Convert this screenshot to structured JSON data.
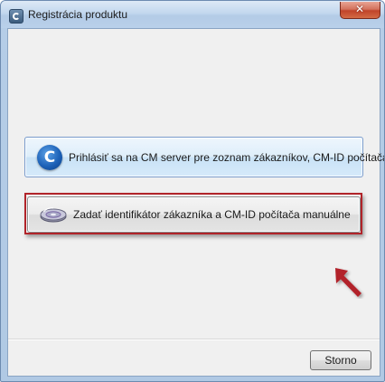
{
  "window": {
    "title": "Registrácia produktu",
    "close_symbol": "✕"
  },
  "options": {
    "login": {
      "logo_letter": "C",
      "label": "Prihlásiť sa na CM server pre zoznam zákazníkov, CM-ID počítača",
      "icon": "cm-logo-icon"
    },
    "manual": {
      "label": "Zadať identifikátor zákazníka a CM-ID počítača manuálne",
      "icon": "disk-icon",
      "highlighted": true
    }
  },
  "footer": {
    "cancel_label": "Storno"
  },
  "colors": {
    "highlight": "#b1242a",
    "accent": "#1d62b8"
  }
}
